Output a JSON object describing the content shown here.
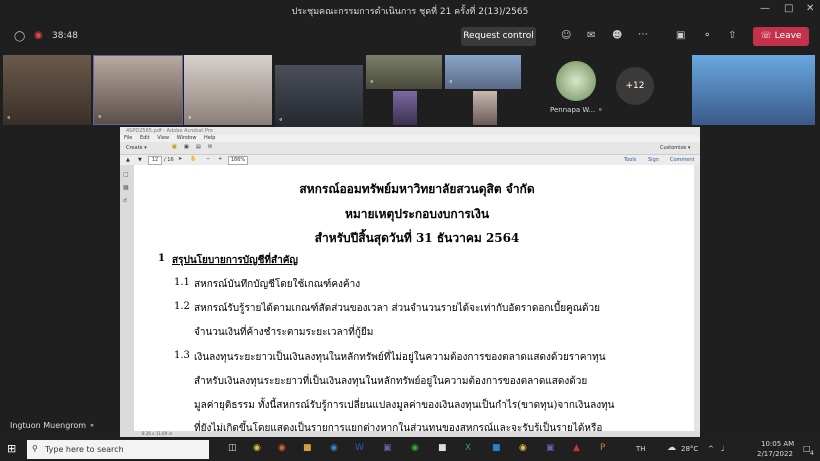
{
  "window": {
    "title": "ประชุมคณะกรรมการดำเนินการ ชุดที่ 21 ครั้งที่ 2(13)/2565"
  },
  "meeting": {
    "timer": "38:48",
    "request_control_label": "Request control",
    "leave_label": "Leave",
    "overflow_count": "+12"
  },
  "participants": {
    "avatar_name": "Pennapa W...",
    "active_speaker": "Ingtuon Muengrom"
  },
  "acrobat": {
    "app_title": "4SPD2565.pdf - Adobe Acrobat Pro",
    "menu": [
      "File",
      "Edit",
      "View",
      "Window",
      "Help"
    ],
    "create_label": "Create",
    "customize_label": "Customize",
    "page_current": "12",
    "page_total": "/ 16",
    "zoom": "186%",
    "tools_label": "Tools",
    "sign_label": "Sign",
    "comment_label": "Comment",
    "status": "8.26 x 11.69 in"
  },
  "document": {
    "heading1": "สหกรณ์ออมทรัพย์มหาวิทยาลัยสวนดุสิต  จำกัด",
    "heading2": "หมายเหตุประกอบงบการเงิน",
    "heading3": "สำหรับปีสิ้นสุดวันที่  31  ธันวาคม  2564",
    "section_num": "1",
    "section_title": "สรุปนโยบายการบัญชีที่สำคัญ",
    "items": [
      {
        "num": "1.1",
        "text": "สหกรณ์บันทึกบัญชีโดยใช้เกณฑ์คงค้าง"
      },
      {
        "num": "1.2",
        "text": "สหกรณ์รับรู้รายได้ตามเกณฑ์สัดส่วนของเวลา ส่วนจำนวนรายได้จะเท่ากับอัตราดอกเบี้ยคูณด้วย"
      },
      {
        "num": "",
        "text": "จำนวนเงินที่ค้างชำระตามระยะเวลาที่กู้ยืม"
      },
      {
        "num": "1.3",
        "text": "เงินลงทุนระยะยาวเป็นเงินลงทุนในหลักทรัพย์ที่ไม่อยู่ในความต้องการของตลาดแสดงด้วยราคาทุน"
      },
      {
        "num": "",
        "text": "สำหรับเงินลงทุนระยะยาวที่เป็นเงินลงทุนในหลักทรัพย์อยู่ในความต้องการของตลาดแสดงด้วย"
      },
      {
        "num": "",
        "text": "มูลค่ายุติธรรม  ทั้งนี้สหกรณ์รับรู้การเปลี่ยนแปลงมูลค่าของเงินลงทุนเป็นกำไร(ขาดทุน)จากเงินลงทุน"
      },
      {
        "num": "",
        "text": "ที่ยังไม่เกิดขึ้นโดยแสดงเป็นรายการแยกต่างหากในส่วนทุนของสหกรณ์และจะรับรู้เป็นรายได้หรือ"
      }
    ]
  },
  "taskbar": {
    "search_placeholder": "Type here to search",
    "language": "TH",
    "temperature": "28°C",
    "time": "10:05 AM",
    "date": "2/17/2022",
    "notification_count": "4"
  },
  "colors": {
    "teams_bg": "#1f1f1f",
    "leave_red": "#c4314b",
    "active_tile_border": "#6264a7"
  }
}
